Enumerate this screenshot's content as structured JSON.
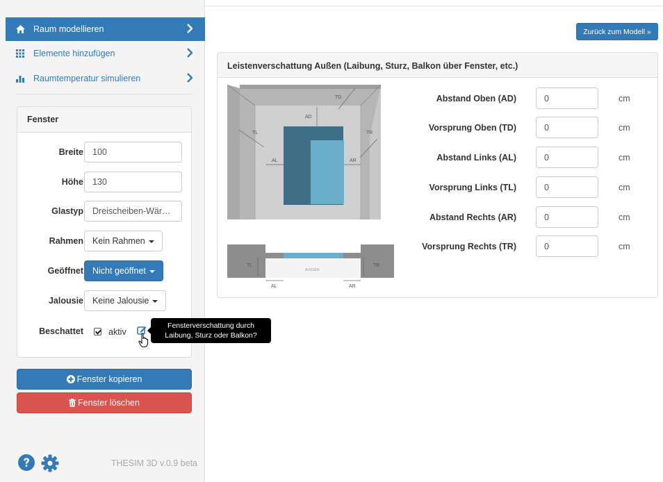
{
  "sidebar": {
    "nav": [
      {
        "label": "Raum modellieren",
        "icon": "home-icon"
      },
      {
        "label": "Elemente hinzufügen",
        "icon": "grid-icon"
      },
      {
        "label": "Raumtemperatur simulieren",
        "icon": "bar-chart-icon"
      }
    ],
    "panel_title": "Fenster",
    "fields": {
      "breite": {
        "label": "Breite",
        "value": "100"
      },
      "hoehe": {
        "label": "Höhe",
        "value": "130"
      },
      "glastyp": {
        "label": "Glastyp",
        "value": "Dreischeiben-Wär…"
      },
      "rahmen": {
        "label": "Rahmen",
        "value": "Kein Rahmen"
      },
      "geoeffnet": {
        "label": "Geöffnet",
        "value": "Nicht geöffnet"
      },
      "jalousie": {
        "label": "Jalousie",
        "value": "Keine Jalousie"
      },
      "beschattet": {
        "label": "Beschattet",
        "checkbox_label": "aktiv",
        "checked": true
      }
    },
    "tooltip": "Fensterverschattung durch Laibung, Sturz oder Balkon?",
    "copy_label": "Fenster kopieren",
    "delete_label": "Fenster löschen",
    "version": "THESIM 3D v.0.9 beta"
  },
  "main": {
    "back_label": "Zurück zum Modell »",
    "panel_title": "Leistenverschattung Außen (Laibung, Sturz, Balkon über Fenster, etc.)",
    "diagram_labels": {
      "td": "TD",
      "ad": "AD",
      "tl": "TL",
      "tr": "TR",
      "al": "AL",
      "ar": "AR",
      "aussen": "AUSSEN"
    },
    "fields": [
      {
        "label": "Abstand Oben (AD)",
        "value": "0",
        "unit": "cm"
      },
      {
        "label": "Vorsprung Oben (TD)",
        "value": "0",
        "unit": "cm"
      },
      {
        "label": "Abstand Links (AL)",
        "value": "0",
        "unit": "cm"
      },
      {
        "label": "Vorsprung Links (TL)",
        "value": "0",
        "unit": "cm"
      },
      {
        "label": "Abstand Rechts (AR)",
        "value": "0",
        "unit": "cm"
      },
      {
        "label": "Vorsprung Rechts (TR)",
        "value": "0",
        "unit": "cm"
      }
    ]
  },
  "colors": {
    "primary": "#337ab7",
    "danger": "#d9534f",
    "window_dark": "#3f6f86",
    "window_light": "#6aaecb"
  }
}
